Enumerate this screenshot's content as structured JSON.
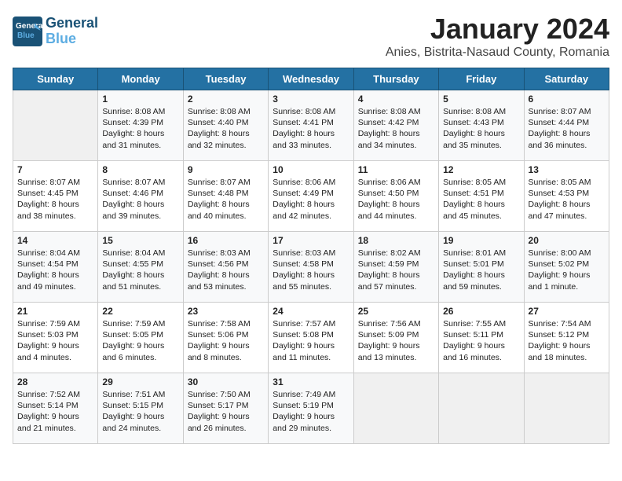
{
  "header": {
    "logo_line1": "General",
    "logo_line2": "Blue",
    "title": "January 2024",
    "subtitle": "Anies, Bistrita-Nasaud County, Romania"
  },
  "days_of_week": [
    "Sunday",
    "Monday",
    "Tuesday",
    "Wednesday",
    "Thursday",
    "Friday",
    "Saturday"
  ],
  "weeks": [
    [
      {
        "day": "",
        "content": ""
      },
      {
        "day": "1",
        "content": "Sunrise: 8:08 AM\nSunset: 4:39 PM\nDaylight: 8 hours\nand 31 minutes."
      },
      {
        "day": "2",
        "content": "Sunrise: 8:08 AM\nSunset: 4:40 PM\nDaylight: 8 hours\nand 32 minutes."
      },
      {
        "day": "3",
        "content": "Sunrise: 8:08 AM\nSunset: 4:41 PM\nDaylight: 8 hours\nand 33 minutes."
      },
      {
        "day": "4",
        "content": "Sunrise: 8:08 AM\nSunset: 4:42 PM\nDaylight: 8 hours\nand 34 minutes."
      },
      {
        "day": "5",
        "content": "Sunrise: 8:08 AM\nSunset: 4:43 PM\nDaylight: 8 hours\nand 35 minutes."
      },
      {
        "day": "6",
        "content": "Sunrise: 8:07 AM\nSunset: 4:44 PM\nDaylight: 8 hours\nand 36 minutes."
      }
    ],
    [
      {
        "day": "7",
        "content": "Sunrise: 8:07 AM\nSunset: 4:45 PM\nDaylight: 8 hours\nand 38 minutes."
      },
      {
        "day": "8",
        "content": "Sunrise: 8:07 AM\nSunset: 4:46 PM\nDaylight: 8 hours\nand 39 minutes."
      },
      {
        "day": "9",
        "content": "Sunrise: 8:07 AM\nSunset: 4:48 PM\nDaylight: 8 hours\nand 40 minutes."
      },
      {
        "day": "10",
        "content": "Sunrise: 8:06 AM\nSunset: 4:49 PM\nDaylight: 8 hours\nand 42 minutes."
      },
      {
        "day": "11",
        "content": "Sunrise: 8:06 AM\nSunset: 4:50 PM\nDaylight: 8 hours\nand 44 minutes."
      },
      {
        "day": "12",
        "content": "Sunrise: 8:05 AM\nSunset: 4:51 PM\nDaylight: 8 hours\nand 45 minutes."
      },
      {
        "day": "13",
        "content": "Sunrise: 8:05 AM\nSunset: 4:53 PM\nDaylight: 8 hours\nand 47 minutes."
      }
    ],
    [
      {
        "day": "14",
        "content": "Sunrise: 8:04 AM\nSunset: 4:54 PM\nDaylight: 8 hours\nand 49 minutes."
      },
      {
        "day": "15",
        "content": "Sunrise: 8:04 AM\nSunset: 4:55 PM\nDaylight: 8 hours\nand 51 minutes."
      },
      {
        "day": "16",
        "content": "Sunrise: 8:03 AM\nSunset: 4:56 PM\nDaylight: 8 hours\nand 53 minutes."
      },
      {
        "day": "17",
        "content": "Sunrise: 8:03 AM\nSunset: 4:58 PM\nDaylight: 8 hours\nand 55 minutes."
      },
      {
        "day": "18",
        "content": "Sunrise: 8:02 AM\nSunset: 4:59 PM\nDaylight: 8 hours\nand 57 minutes."
      },
      {
        "day": "19",
        "content": "Sunrise: 8:01 AM\nSunset: 5:01 PM\nDaylight: 8 hours\nand 59 minutes."
      },
      {
        "day": "20",
        "content": "Sunrise: 8:00 AM\nSunset: 5:02 PM\nDaylight: 9 hours\nand 1 minute."
      }
    ],
    [
      {
        "day": "21",
        "content": "Sunrise: 7:59 AM\nSunset: 5:03 PM\nDaylight: 9 hours\nand 4 minutes."
      },
      {
        "day": "22",
        "content": "Sunrise: 7:59 AM\nSunset: 5:05 PM\nDaylight: 9 hours\nand 6 minutes."
      },
      {
        "day": "23",
        "content": "Sunrise: 7:58 AM\nSunset: 5:06 PM\nDaylight: 9 hours\nand 8 minutes."
      },
      {
        "day": "24",
        "content": "Sunrise: 7:57 AM\nSunset: 5:08 PM\nDaylight: 9 hours\nand 11 minutes."
      },
      {
        "day": "25",
        "content": "Sunrise: 7:56 AM\nSunset: 5:09 PM\nDaylight: 9 hours\nand 13 minutes."
      },
      {
        "day": "26",
        "content": "Sunrise: 7:55 AM\nSunset: 5:11 PM\nDaylight: 9 hours\nand 16 minutes."
      },
      {
        "day": "27",
        "content": "Sunrise: 7:54 AM\nSunset: 5:12 PM\nDaylight: 9 hours\nand 18 minutes."
      }
    ],
    [
      {
        "day": "28",
        "content": "Sunrise: 7:52 AM\nSunset: 5:14 PM\nDaylight: 9 hours\nand 21 minutes."
      },
      {
        "day": "29",
        "content": "Sunrise: 7:51 AM\nSunset: 5:15 PM\nDaylight: 9 hours\nand 24 minutes."
      },
      {
        "day": "30",
        "content": "Sunrise: 7:50 AM\nSunset: 5:17 PM\nDaylight: 9 hours\nand 26 minutes."
      },
      {
        "day": "31",
        "content": "Sunrise: 7:49 AM\nSunset: 5:19 PM\nDaylight: 9 hours\nand 29 minutes."
      },
      {
        "day": "",
        "content": ""
      },
      {
        "day": "",
        "content": ""
      },
      {
        "day": "",
        "content": ""
      }
    ]
  ]
}
